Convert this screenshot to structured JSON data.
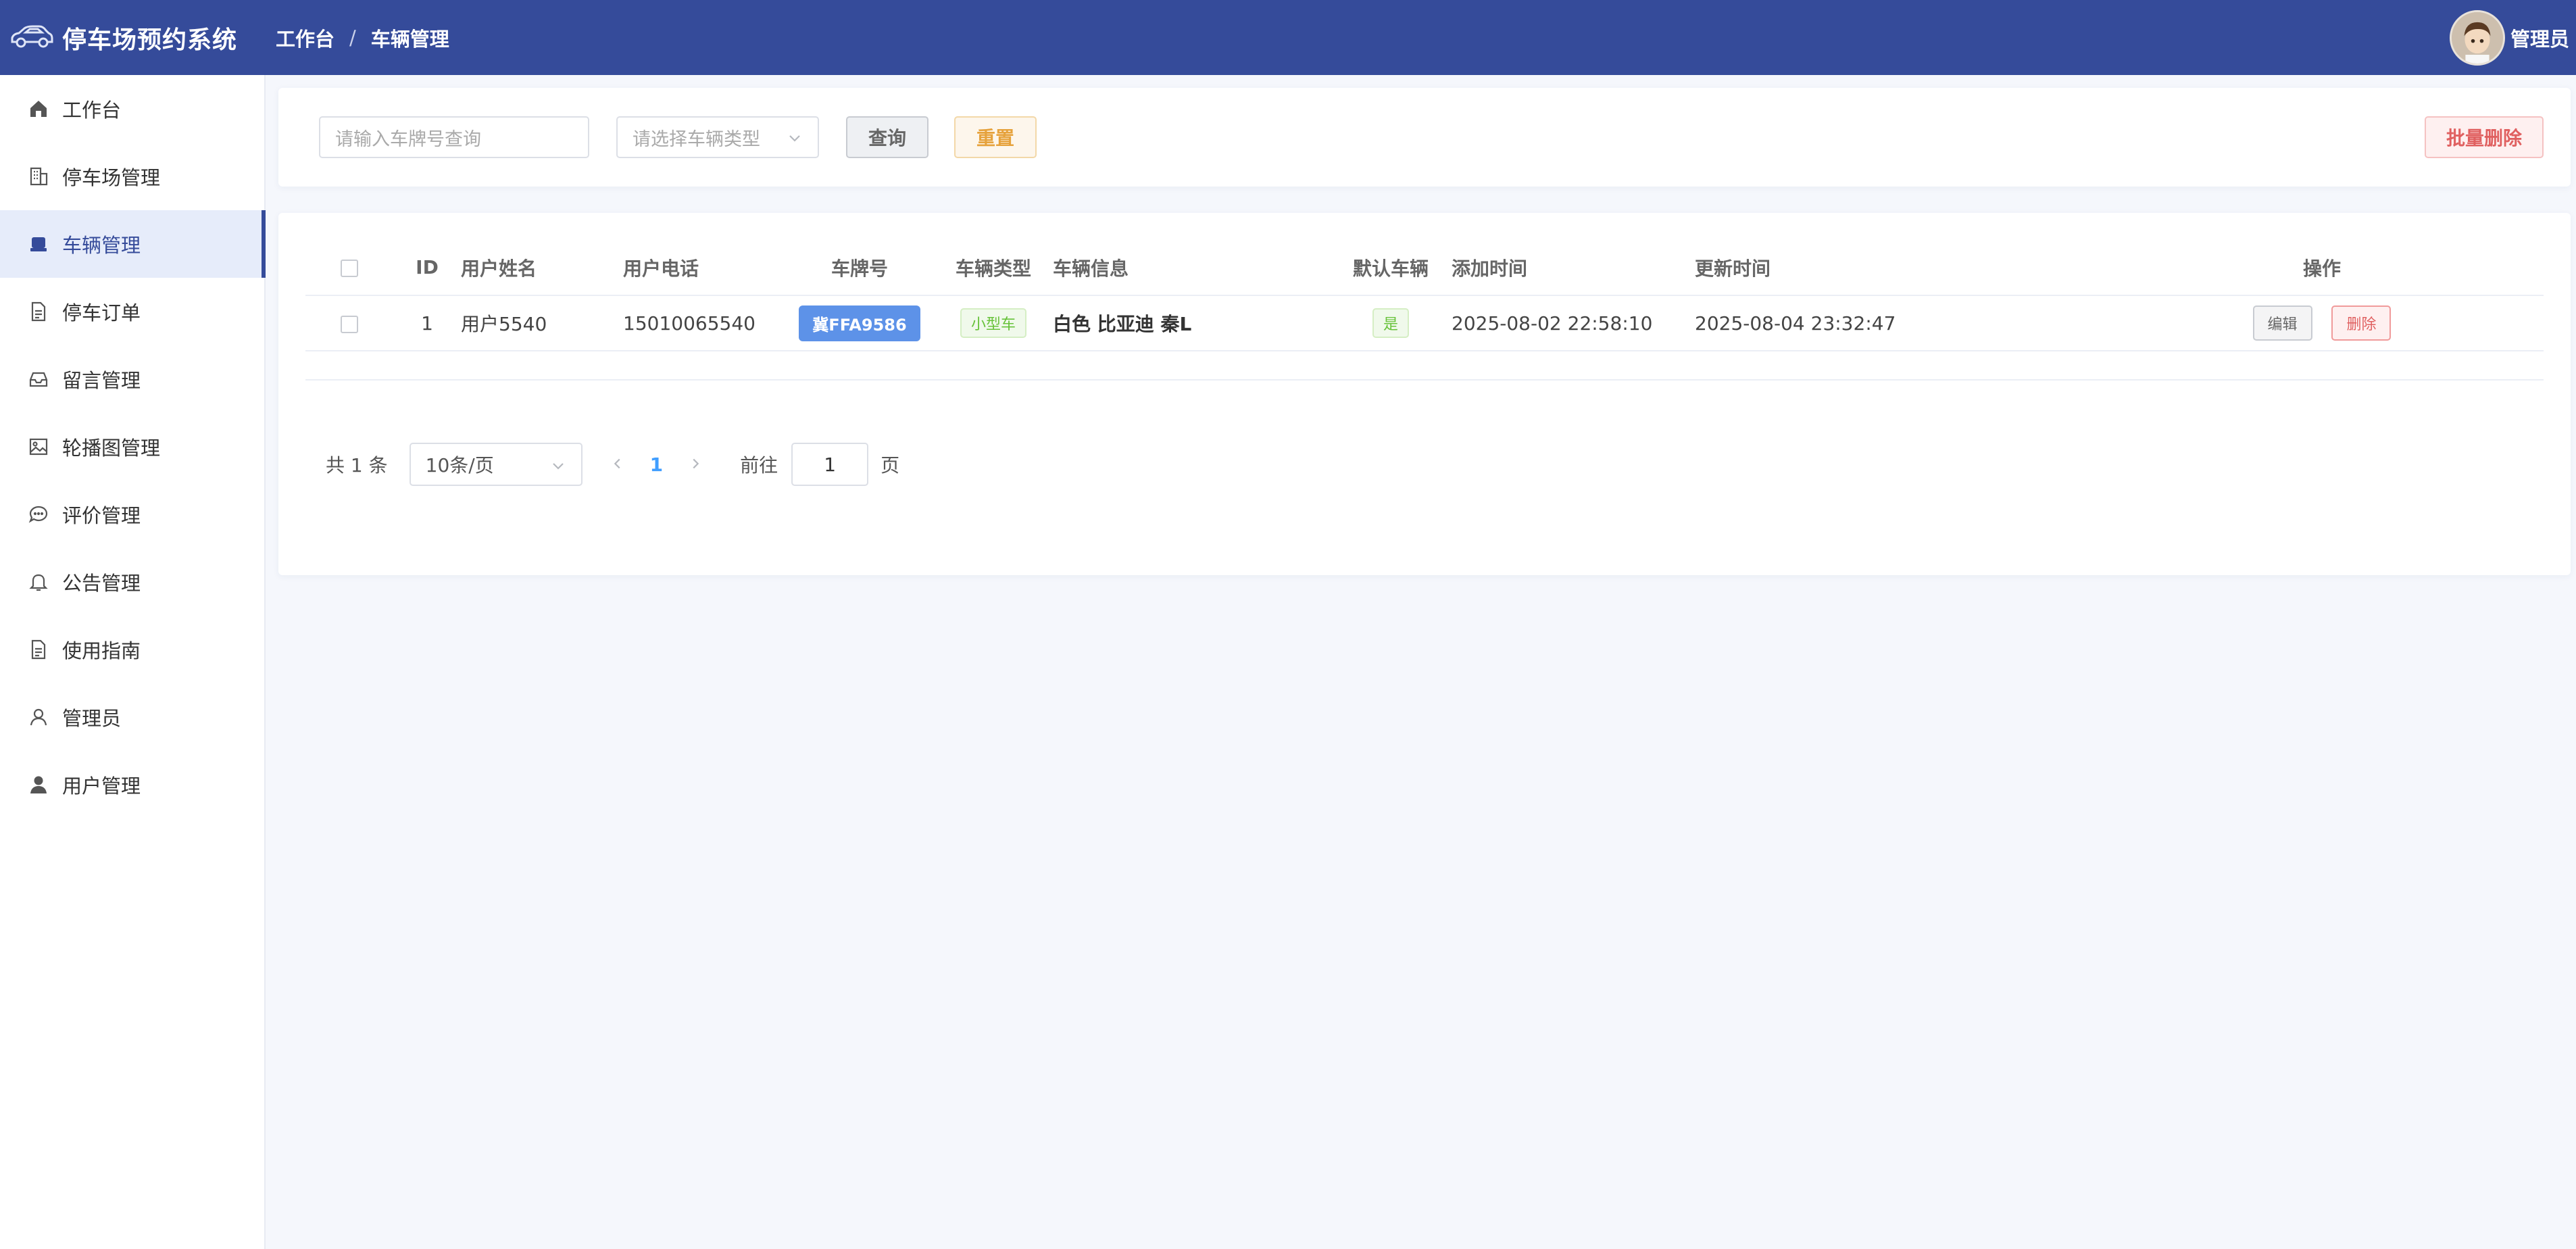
{
  "app": {
    "title": "停车场预约系统"
  },
  "breadcrumb": {
    "home": "工作台",
    "separator": "/",
    "current": "车辆管理"
  },
  "user": {
    "name": "管理员"
  },
  "sidebar": {
    "items": [
      {
        "label": "工作台",
        "icon": "home-icon"
      },
      {
        "label": "停车场管理",
        "icon": "building-icon"
      },
      {
        "label": "车辆管理",
        "icon": "car-icon",
        "active": true
      },
      {
        "label": "停车订单",
        "icon": "document-icon"
      },
      {
        "label": "留言管理",
        "icon": "inbox-icon"
      },
      {
        "label": "轮播图管理",
        "icon": "image-icon"
      },
      {
        "label": "评价管理",
        "icon": "chat-icon"
      },
      {
        "label": "公告管理",
        "icon": "bell-icon"
      },
      {
        "label": "使用指南",
        "icon": "document-icon"
      },
      {
        "label": "管理员",
        "icon": "user-outline-icon"
      },
      {
        "label": "用户管理",
        "icon": "user-filled-icon"
      }
    ]
  },
  "search": {
    "plate_placeholder": "请输入车牌号查询",
    "type_placeholder": "请选择车辆类型",
    "query_label": "查询",
    "reset_label": "重置",
    "batch_delete_label": "批量删除"
  },
  "table": {
    "headers": {
      "id": "ID",
      "user_name": "用户姓名",
      "phone": "用户电话",
      "plate": "车牌号",
      "type": "车辆类型",
      "info": "车辆信息",
      "default": "默认车辆",
      "created": "添加时间",
      "updated": "更新时间",
      "actions": "操作"
    },
    "rows": [
      {
        "id": "1",
        "user_name": "用户5540",
        "phone": "15010065540",
        "plate": "冀FFA9586",
        "type": "小型车",
        "info": "白色 比亚迪 秦L",
        "default": "是",
        "created": "2025-08-02 22:58:10",
        "updated": "2025-08-04 23:32:47",
        "edit_label": "编辑",
        "delete_label": "删除"
      }
    ]
  },
  "pagination": {
    "total_text": "共 1 条",
    "page_size": "10条/页",
    "current_page": "1",
    "goto_prefix": "前往",
    "goto_value": "1",
    "goto_suffix": "页"
  },
  "colors": {
    "header": "#354b9a",
    "accent": "#409eff",
    "plate": "#5d92e8",
    "success": "#67c23a",
    "danger": "#e06060",
    "warning": "#e6a23c"
  }
}
